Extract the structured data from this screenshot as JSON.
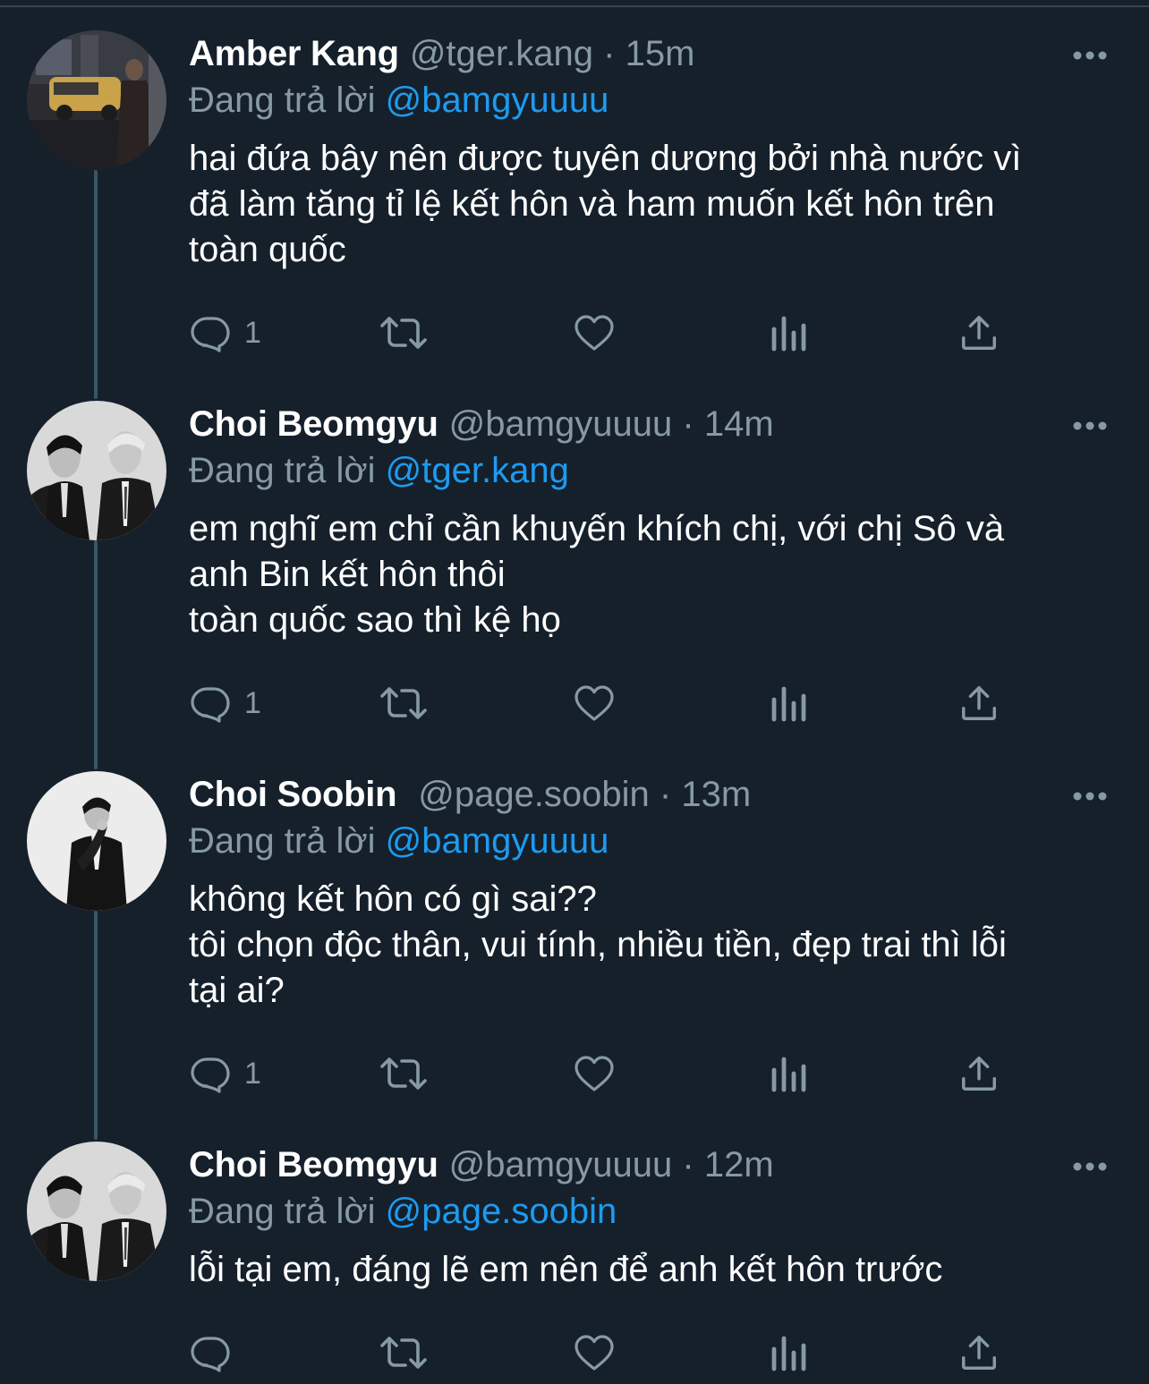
{
  "tweets": [
    {
      "name": "Amber Kang",
      "handle": "@tger.kang",
      "dot": "·",
      "time": "15m",
      "reply_prefix": "Đang trả lời",
      "reply_to": "@bamgyuuuu",
      "text": "hai đứa bây nên được tuyên dương bởi nhà nước vì\nđã làm tăng tỉ lệ kết hôn và ham muốn kết hôn trên\ntoàn quốc",
      "reply_count": "1"
    },
    {
      "name": "Choi Beomgyu",
      "handle": "@bamgyuuuu",
      "dot": "·",
      "time": "14m",
      "reply_prefix": "Đang trả lời",
      "reply_to": "@tger.kang",
      "text": "em nghĩ em chỉ cần khuyến khích chị, với chị Sô và\nanh Bin kết hôn thôi\ntoàn quốc sao thì kệ họ",
      "reply_count": "1"
    },
    {
      "name": "Choi Soobin",
      "handle": "@page.soobin",
      "dot": "·",
      "time": "13m",
      "reply_prefix": "Đang trả lời",
      "reply_to": "@bamgyuuuu",
      "text": "không kết hôn có gì sai??\ntôi chọn độc thân, vui tính, nhiều tiền, đẹp trai thì lỗi\ntại ai?",
      "reply_count": "1"
    },
    {
      "name": "Choi Beomgyu",
      "handle": "@bamgyuuuu",
      "dot": "·",
      "time": "12m",
      "reply_prefix": "Đang trả lời",
      "reply_to": "@page.soobin",
      "text": "lỗi tại em, đáng lẽ em nên để anh kết hôn trước",
      "reply_count": ""
    }
  ],
  "icons": {
    "reply": "reply-icon",
    "retweet": "retweet-icon",
    "like": "heart-icon",
    "analytics": "analytics-icon",
    "share": "share-icon",
    "more": "more-icon"
  },
  "colors": {
    "background": "#15202b",
    "secondary_text": "#8899a6",
    "link": "#1d9bf0",
    "thread_line": "#3d5466"
  }
}
